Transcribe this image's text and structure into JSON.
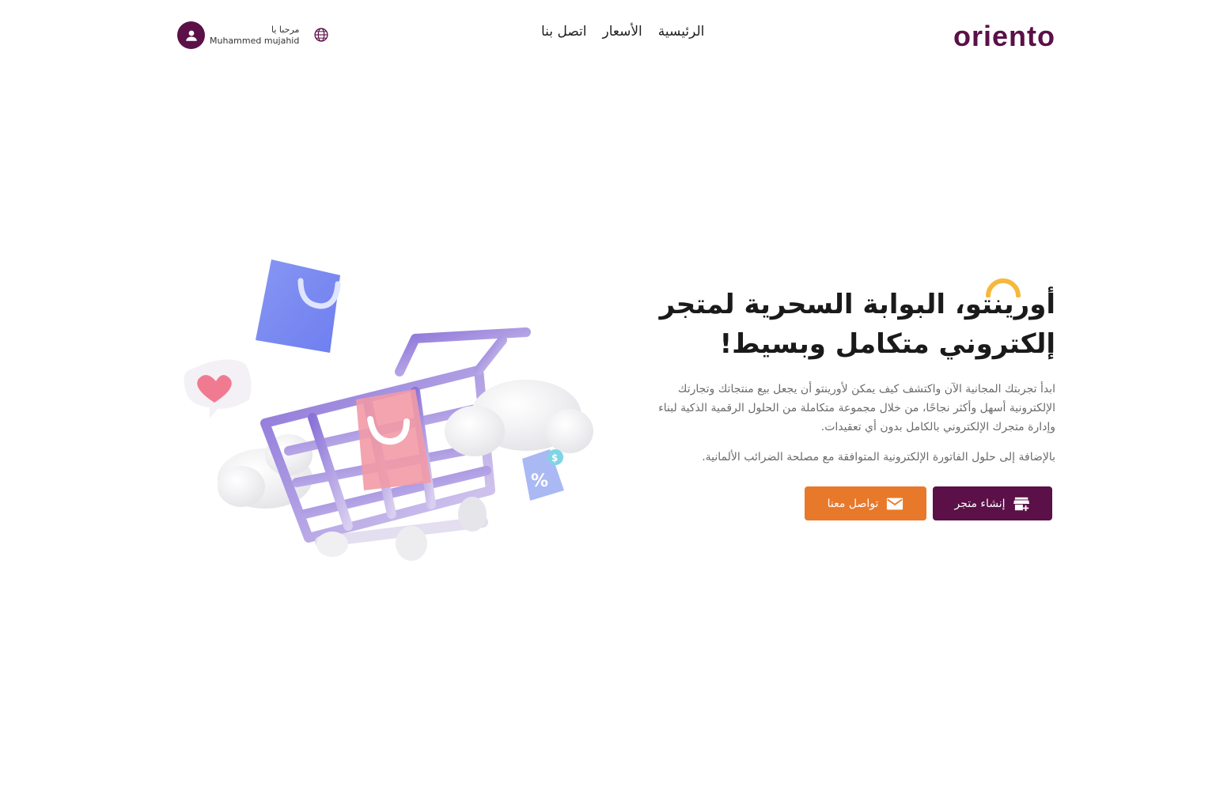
{
  "header": {
    "logo_text": "oriento",
    "nav": [
      {
        "label": "الرئيسية"
      },
      {
        "label": "الأسعار"
      },
      {
        "label": "اتصل بنا"
      }
    ],
    "user": {
      "greeting": "مرحبا يا",
      "name": "Muhammed mujahid"
    }
  },
  "hero": {
    "title": "أورينتو، البوابة السحرية لمتجر إلكتروني متكامل وبسيط!",
    "description": "ابدأ تجربتك المجانية الآن واكتشف كيف يمكن لأورينتو أن يجعل بيع منتجاتك وتجارتك الإلكترونية أسهل وأكثر نجاحًا، من خلال مجموعة متكاملة من الحلول الرقمية الذكية لبناء وإدارة متجرك الإلكتروني بالكامل بدون أي تعقيدات.",
    "extra": "بالإضافة إلى حلول الفاتورة الإلكترونية المتوافقة مع مصلحة الضرائب الألمانية.",
    "create_store_label": "إنشاء متجر",
    "contact_label": "تواصل معنا"
  },
  "colors": {
    "brand": "#5b1048",
    "accent": "#e8792a",
    "highlight": "#f5b83d"
  },
  "icons": {
    "user": "user-icon",
    "globe": "globe-icon",
    "store": "store-add-icon",
    "mail": "mail-icon"
  }
}
